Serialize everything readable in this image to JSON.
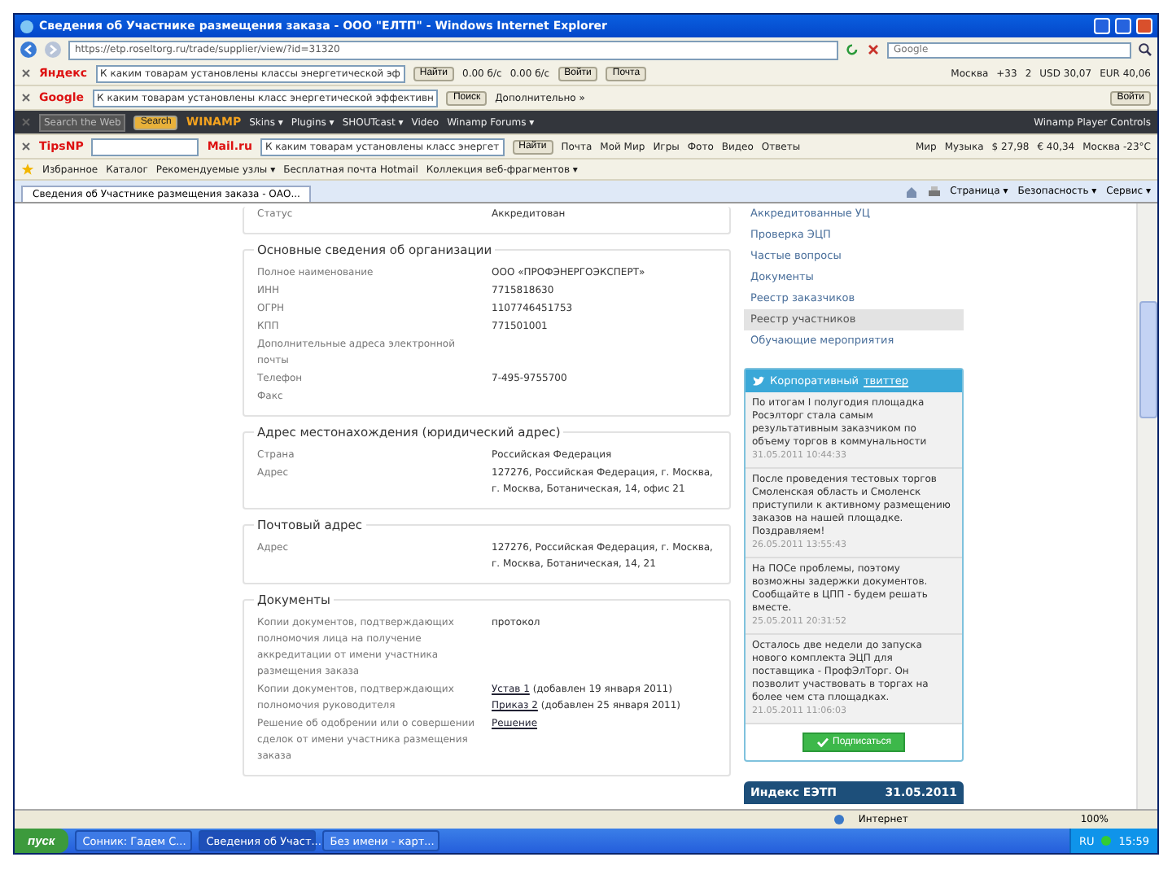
{
  "window": {
    "title": "Сведения об Участнике размещения заказа - ООО \"ЕЛТП\" - Windows Internet Explorer"
  },
  "address_bar": {
    "url": "https://etp.roseltorg.ru/trade/supplier/view/?id=31320",
    "search_placeholder": "Google"
  },
  "toolbars": [
    {
      "kind": "light",
      "items": [
        {
          "kind": "logo",
          "text": "Яндекс"
        },
        {
          "kind": "field",
          "text": "К каким товарам установлены классы энергетической эф"
        },
        {
          "kind": "button",
          "text": "Найти"
        },
        {
          "kind": "text",
          "text": "0.00 б/с"
        },
        {
          "kind": "text",
          "text": "0.00 б/с"
        },
        {
          "kind": "button",
          "text": "Войти"
        },
        {
          "kind": "button",
          "text": "Почта"
        }
      ],
      "right": [
        {
          "kind": "text",
          "text": "Москва"
        },
        {
          "kind": "text",
          "text": "+33"
        },
        {
          "kind": "text",
          "text": "2"
        },
        {
          "kind": "text",
          "text": "USD 30,07"
        },
        {
          "kind": "text",
          "text": "EUR 40,06"
        }
      ]
    },
    {
      "kind": "light",
      "items": [
        {
          "kind": "logo",
          "text": "Google"
        },
        {
          "kind": "field",
          "text": "К каким товарам установлены класс энергетической эффективн"
        },
        {
          "kind": "button",
          "text": "Поиск"
        },
        {
          "kind": "text",
          "text": "Дополнительно »"
        }
      ],
      "right": [
        {
          "kind": "button",
          "text": "Войти"
        }
      ]
    },
    {
      "kind": "dark",
      "items": [
        {
          "kind": "field",
          "text": "Search the Web"
        },
        {
          "kind": "button",
          "text": "Search"
        },
        {
          "kind": "logo",
          "text": "WINAMP"
        },
        {
          "kind": "text",
          "text": "Skins ▾"
        },
        {
          "kind": "text",
          "text": "Plugins ▾"
        },
        {
          "kind": "text",
          "text": "SHOUTcast ▾"
        },
        {
          "kind": "text",
          "text": "Video"
        },
        {
          "kind": "text",
          "text": "Winamp Forums ▾"
        }
      ],
      "right": [
        {
          "kind": "text",
          "text": "Winamp Player Controls"
        }
      ]
    },
    {
      "kind": "light",
      "items": [
        {
          "kind": "logo",
          "text": "TipsNP"
        },
        {
          "kind": "field"
        },
        {
          "kind": "logo",
          "text": "Mail.ru"
        },
        {
          "kind": "field",
          "text": "К каким товарам установлены класс энергет"
        },
        {
          "kind": "button",
          "text": "Найти"
        },
        {
          "kind": "text",
          "text": "Почта"
        },
        {
          "kind": "text",
          "text": "Мой Мир"
        },
        {
          "kind": "text",
          "text": "Игры"
        },
        {
          "kind": "text",
          "text": "Фото"
        },
        {
          "kind": "text",
          "text": "Видео"
        },
        {
          "kind": "text",
          "text": "Ответы"
        }
      ],
      "right": [
        {
          "kind": "text",
          "text": "Мир"
        },
        {
          "kind": "text",
          "text": "Музыка"
        },
        {
          "kind": "text",
          "text": "$ 27,98"
        },
        {
          "kind": "text",
          "text": "€ 40,34"
        },
        {
          "kind": "text",
          "text": "Москва -23°C"
        }
      ]
    }
  ],
  "favorites_bar": {
    "items": [
      "Избранное",
      "Каталог",
      "Рекомендуемые узлы ▾",
      "Бесплатная почта Hotmail",
      "Коллекция веб-фрагментов ▾"
    ]
  },
  "tabs": [
    {
      "label": "Сведения об Участнике размещения заказа - ОАО...",
      "selected": true
    }
  ],
  "command_bar": [
    "Страница ▾",
    "Безопасность ▾",
    "Сервис ▾"
  ],
  "page": {
    "top_row": {
      "label": "Статус",
      "value": "Аккредитован"
    },
    "sections": [
      {
        "title": "Основные сведения об организации",
        "rows": [
          {
            "label": "Полное наименование",
            "value": "ООО «ПРОФЭНЕРГОЭКСПЕРТ»"
          },
          {
            "label": "ИНН",
            "value": "7715818630"
          },
          {
            "label": "ОГРН",
            "value": "1107746451753"
          },
          {
            "label": "КПП",
            "value": "771501001"
          },
          {
            "label": "Дополнительные адреса электронной почты"
          },
          {
            "label": "Телефон",
            "value": "7-495-9755700"
          },
          {
            "label": "Факс"
          }
        ]
      },
      {
        "title": "Адрес местонахождения (юридический адрес)",
        "rows": [
          {
            "label": "Страна",
            "value": "Российская Федерация"
          },
          {
            "label": "Адрес",
            "value": "127276, Российская Федерация, г. Москва, г. Москва, Ботаническая, 14, офис 21"
          }
        ]
      },
      {
        "title": "Почтовый адрес",
        "rows": [
          {
            "label": "Адрес",
            "value": "127276, Российская Федерация, г. Москва, г. Москва, Ботаническая, 14, 21"
          }
        ]
      },
      {
        "title": "Документы",
        "rows": [
          {
            "label": "Копии документов, подтверждающих полномочия лица на получение аккредитации от имени участника размещения заказа",
            "value": "протокол"
          },
          {
            "label": "Копии документов, подтверждающих полномочия руководителя",
            "links": [
              {
                "text": "Устав 1",
                "note": "(добавлен 19 января 2011)"
              },
              {
                "text": "Приказ 2",
                "note": "(добавлен 25 января 2011)"
              }
            ]
          },
          {
            "label": "Решение об одобрении или о совершении сделок от имени участника размещения заказа",
            "links": [
              {
                "text": "Решение"
              }
            ]
          }
        ]
      }
    ]
  },
  "sidebar": {
    "menu": [
      {
        "label": "Аккредитованные УЦ",
        "selected": false
      },
      {
        "label": "Проверка ЭЦП",
        "selected": false
      },
      {
        "label": "Частые вопросы",
        "selected": false
      },
      {
        "label": "Документы",
        "selected": false
      },
      {
        "label": "Реестр заказчиков",
        "selected": false
      },
      {
        "label": "Реестр участников",
        "selected": true
      },
      {
        "label": "Обучающие мероприятия",
        "selected": false
      }
    ],
    "twitter": {
      "title": "Корпоративный",
      "link": "твиттер",
      "tweets": [
        {
          "text": "По итогам I полугодия площадка Росэлторг стала самым результативным заказчиком по объему торгов в коммунальности",
          "date": "31.05.2011 10:44:33"
        },
        {
          "text": "После проведения тестовых торгов Смоленская область и Смоленск приступили к активному размещению заказов на нашей площадке. Поздравляем!",
          "date": "26.05.2011 13:55:43"
        },
        {
          "text": "На ПОСе проблемы, поэтому возможны задержки документов. Сообщайте в ЦПП - будем решать вместе.",
          "date": "25.05.2011 20:31:52"
        },
        {
          "text": "Осталось две недели до запуска нового комплекта ЭЦП для поставщика - ПрофЭлТорг. Он позволит участвовать в торгах на более чем ста площадках.",
          "date": "21.05.2011 11:06:03"
        }
      ],
      "button": "Подписаться"
    },
    "index": {
      "title": "Индекс ЕЭТП",
      "date": "31.05.2011"
    }
  },
  "status_bar": {
    "zone": "Интернет",
    "zoom": "100%"
  },
  "taskbar": {
    "start": "пуск",
    "tasks": [
      {
        "label": "Сонник: Гадем С...",
        "selected": false
      },
      {
        "label": "Сведения об Участ...",
        "selected": true
      },
      {
        "label": "Без имени - карт...",
        "selected": false
      }
    ],
    "lang": "RU",
    "clock": "15:59"
  }
}
